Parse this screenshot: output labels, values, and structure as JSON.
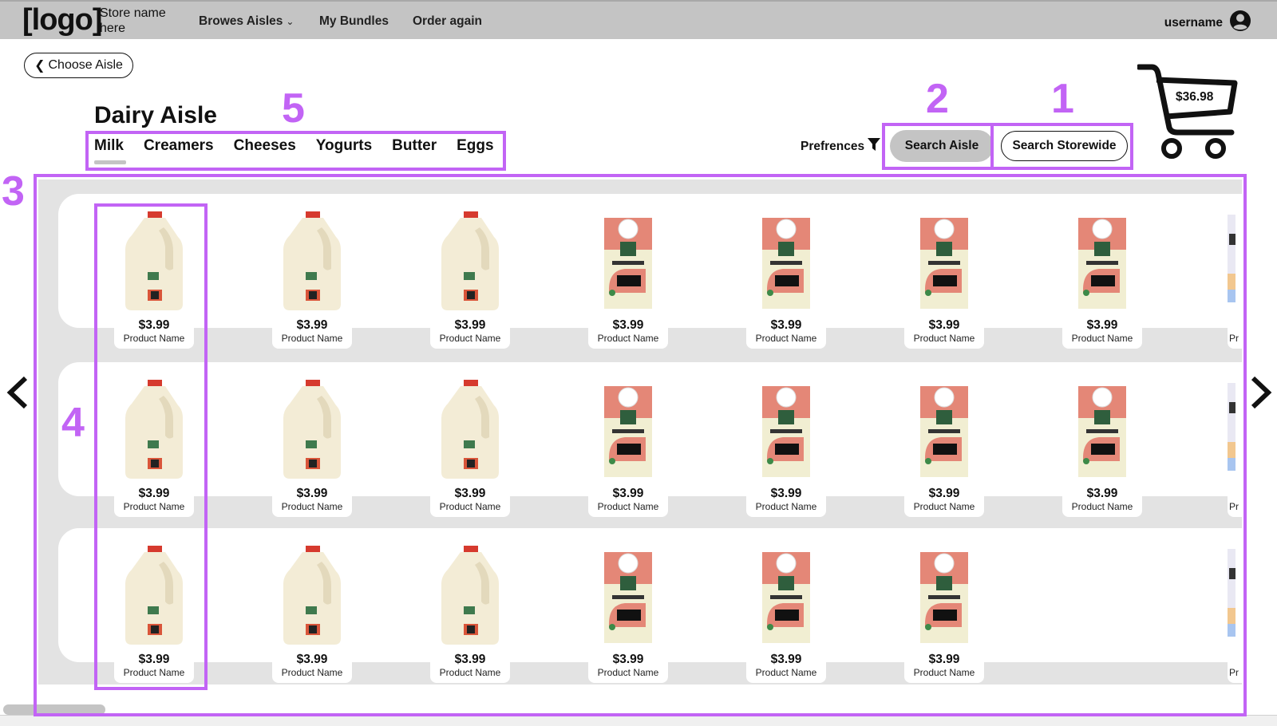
{
  "header": {
    "logo": "[logo]",
    "store_name": "Store name here",
    "nav": [
      {
        "label": "Browes Aisles",
        "has_dropdown": true
      },
      {
        "label": "My Bundles"
      },
      {
        "label": "Order again"
      }
    ],
    "username": "username",
    "user_icon": "user-circle-icon"
  },
  "back_button": {
    "label": "Choose Aisle",
    "icon": "chevron-left-icon"
  },
  "page_title": "Dairy Aisle",
  "tabs": [
    {
      "label": "Milk",
      "active": true
    },
    {
      "label": "Creamers"
    },
    {
      "label": "Cheeses"
    },
    {
      "label": "Yogurts"
    },
    {
      "label": "Butter"
    },
    {
      "label": "Eggs"
    }
  ],
  "preferences": {
    "label": "Prefrences",
    "icon": "filter-icon"
  },
  "search_aisle": {
    "label": "Search Aisle"
  },
  "search_storewide": {
    "label": "Search Storewide"
  },
  "cart": {
    "total": "$36.98",
    "icon": "shopping-cart-icon"
  },
  "annotations": [
    "1",
    "2",
    "3",
    "4",
    "5"
  ],
  "shelves": [
    {
      "products": [
        {
          "type": "milk",
          "price": "$3.99",
          "name": "Product Name"
        },
        {
          "type": "milk",
          "price": "$3.99",
          "name": "Product Name"
        },
        {
          "type": "milk",
          "price": "$3.99",
          "name": "Product Name"
        },
        {
          "type": "cream",
          "price": "$3.99",
          "name": "Product Name"
        },
        {
          "type": "cream",
          "price": "$3.99",
          "name": "Product Name"
        },
        {
          "type": "cream",
          "price": "$3.99",
          "name": "Product Name"
        },
        {
          "type": "cream",
          "price": "$3.99",
          "name": "Product Name"
        },
        {
          "type": "partial",
          "price": "",
          "name": "Pr"
        }
      ]
    },
    {
      "products": [
        {
          "type": "milk",
          "price": "$3.99",
          "name": "Product Name"
        },
        {
          "type": "milk",
          "price": "$3.99",
          "name": "Product Name"
        },
        {
          "type": "milk",
          "price": "$3.99",
          "name": "Product Name"
        },
        {
          "type": "cream",
          "price": "$3.99",
          "name": "Product Name"
        },
        {
          "type": "cream",
          "price": "$3.99",
          "name": "Product Name"
        },
        {
          "type": "cream",
          "price": "$3.99",
          "name": "Product Name"
        },
        {
          "type": "cream",
          "price": "$3.99",
          "name": "Product Name"
        },
        {
          "type": "partial",
          "price": "",
          "name": "Pr"
        }
      ]
    },
    {
      "products": [
        {
          "type": "milk",
          "price": "$3.99",
          "name": "Product Name"
        },
        {
          "type": "milk",
          "price": "$3.99",
          "name": "Product Name"
        },
        {
          "type": "milk",
          "price": "$3.99",
          "name": "Product Name"
        },
        {
          "type": "cream",
          "price": "$3.99",
          "name": "Product Name"
        },
        {
          "type": "cream",
          "price": "$3.99",
          "name": "Product Name"
        },
        {
          "type": "cream",
          "price": "$3.99",
          "name": "Product Name"
        },
        {
          "type": "empty",
          "price": "",
          "name": ""
        },
        {
          "type": "partial",
          "price": "",
          "name": "Pr"
        }
      ]
    }
  ],
  "colors": {
    "annotation": "#c264f5",
    "topbar": "#c4c4c4",
    "shelf_bg": "#e3e3e3"
  }
}
